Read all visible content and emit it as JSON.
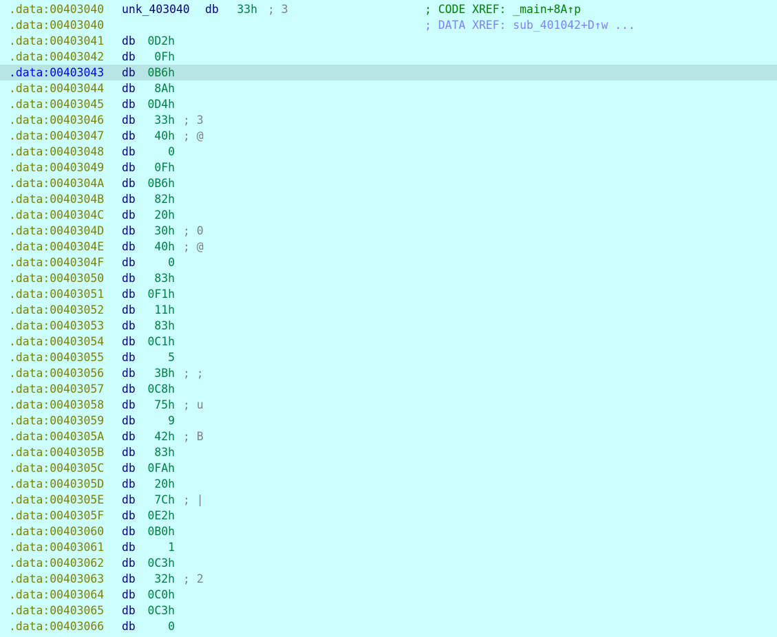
{
  "colors": {
    "background": "#ccffff",
    "selection": "#b7e5e5",
    "address": "#7f7f00",
    "address_selected": "#0000ff",
    "mnemonic": "#000080",
    "value": "#008040",
    "comment": "#808080",
    "code_xref": "#008000",
    "data_xref": "#8080ff"
  },
  "header": {
    "row1": {
      "addr": ".data:00403040",
      "name": "unk_403040",
      "mnem": "db",
      "val": "33h",
      "cmt": "; 3",
      "xref": "; CODE XREF: _main+8A↑p"
    },
    "row2": {
      "addr": ".data:00403040",
      "xref": "; DATA XREF: sub_401042+D↑w ..."
    }
  },
  "rows": [
    {
      "addr": ".data:00403041",
      "mnem": "db",
      "val": "0D2h",
      "cmt": ""
    },
    {
      "addr": ".data:00403042",
      "mnem": "db",
      "val": "0Fh",
      "cmt": ""
    },
    {
      "addr": ".data:00403043",
      "mnem": "db",
      "val": "0B6h",
      "cmt": ""
    },
    {
      "addr": ".data:00403044",
      "mnem": "db",
      "val": "8Ah",
      "cmt": ""
    },
    {
      "addr": ".data:00403045",
      "mnem": "db",
      "val": "0D4h",
      "cmt": ""
    },
    {
      "addr": ".data:00403046",
      "mnem": "db",
      "val": "33h",
      "cmt": "; 3"
    },
    {
      "addr": ".data:00403047",
      "mnem": "db",
      "val": "40h",
      "cmt": "; @"
    },
    {
      "addr": ".data:00403048",
      "mnem": "db",
      "val": "0",
      "cmt": ""
    },
    {
      "addr": ".data:00403049",
      "mnem": "db",
      "val": "0Fh",
      "cmt": ""
    },
    {
      "addr": ".data:0040304A",
      "mnem": "db",
      "val": "0B6h",
      "cmt": ""
    },
    {
      "addr": ".data:0040304B",
      "mnem": "db",
      "val": "82h",
      "cmt": ""
    },
    {
      "addr": ".data:0040304C",
      "mnem": "db",
      "val": "20h",
      "cmt": ""
    },
    {
      "addr": ".data:0040304D",
      "mnem": "db",
      "val": "30h",
      "cmt": "; 0"
    },
    {
      "addr": ".data:0040304E",
      "mnem": "db",
      "val": "40h",
      "cmt": "; @"
    },
    {
      "addr": ".data:0040304F",
      "mnem": "db",
      "val": "0",
      "cmt": ""
    },
    {
      "addr": ".data:00403050",
      "mnem": "db",
      "val": "83h",
      "cmt": ""
    },
    {
      "addr": ".data:00403051",
      "mnem": "db",
      "val": "0F1h",
      "cmt": ""
    },
    {
      "addr": ".data:00403052",
      "mnem": "db",
      "val": "11h",
      "cmt": ""
    },
    {
      "addr": ".data:00403053",
      "mnem": "db",
      "val": "83h",
      "cmt": ""
    },
    {
      "addr": ".data:00403054",
      "mnem": "db",
      "val": "0C1h",
      "cmt": ""
    },
    {
      "addr": ".data:00403055",
      "mnem": "db",
      "val": "5",
      "cmt": ""
    },
    {
      "addr": ".data:00403056",
      "mnem": "db",
      "val": "3Bh",
      "cmt": "; ;"
    },
    {
      "addr": ".data:00403057",
      "mnem": "db",
      "val": "0C8h",
      "cmt": ""
    },
    {
      "addr": ".data:00403058",
      "mnem": "db",
      "val": "75h",
      "cmt": "; u"
    },
    {
      "addr": ".data:00403059",
      "mnem": "db",
      "val": "9",
      "cmt": ""
    },
    {
      "addr": ".data:0040305A",
      "mnem": "db",
      "val": "42h",
      "cmt": "; B"
    },
    {
      "addr": ".data:0040305B",
      "mnem": "db",
      "val": "83h",
      "cmt": ""
    },
    {
      "addr": ".data:0040305C",
      "mnem": "db",
      "val": "0FAh",
      "cmt": ""
    },
    {
      "addr": ".data:0040305D",
      "mnem": "db",
      "val": "20h",
      "cmt": ""
    },
    {
      "addr": ".data:0040305E",
      "mnem": "db",
      "val": "7Ch",
      "cmt": "; |"
    },
    {
      "addr": ".data:0040305F",
      "mnem": "db",
      "val": "0E2h",
      "cmt": ""
    },
    {
      "addr": ".data:00403060",
      "mnem": "db",
      "val": "0B0h",
      "cmt": ""
    },
    {
      "addr": ".data:00403061",
      "mnem": "db",
      "val": "1",
      "cmt": ""
    },
    {
      "addr": ".data:00403062",
      "mnem": "db",
      "val": "0C3h",
      "cmt": ""
    },
    {
      "addr": ".data:00403063",
      "mnem": "db",
      "val": "32h",
      "cmt": "; 2"
    },
    {
      "addr": ".data:00403064",
      "mnem": "db",
      "val": "0C0h",
      "cmt": ""
    },
    {
      "addr": ".data:00403065",
      "mnem": "db",
      "val": "0C3h",
      "cmt": ""
    },
    {
      "addr": ".data:00403066",
      "mnem": "db",
      "val": "0",
      "cmt": ""
    }
  ]
}
